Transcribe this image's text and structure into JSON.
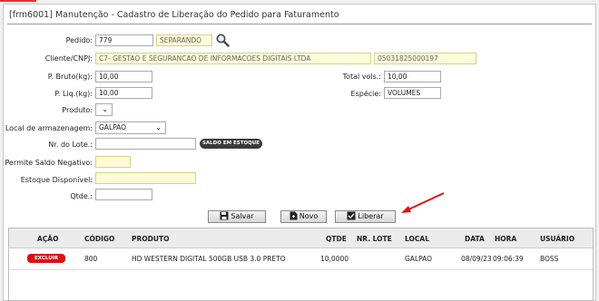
{
  "title": "[frm6001] Manutenção - Cadastro de Liberação do Pedido para Faturamento",
  "form": {
    "pedido_label": "Pedido:",
    "pedido_value": "779",
    "status_value": "SEPARANDO",
    "cliente_label": "Cliente/CNPJ:",
    "cliente_value": "C7- GESTAO E SEGURANCAO DE INFORMACOES DIGITAIS LTDA",
    "cnpj_value": "05031825000197",
    "peso_bruto_label": "P. Bruto(kg):",
    "peso_bruto_value": "10,00",
    "total_vols_label": "Total vols.:",
    "total_vols_value": "10,00",
    "peso_liq_label": "P. Liq.(kg):",
    "peso_liq_value": "10,00",
    "especie_label": "Espécie:",
    "especie_value": "VOLUMES",
    "produto_label": "Produto:",
    "produto_value": "",
    "local_label": "Local de armazenagem:",
    "local_value": "GALPAO",
    "lote_label": "Nr. do Lote.:",
    "lote_value": "",
    "saldo_button": "SALDO EM ESTOQUE",
    "permite_label": "Permite Saldo Negativo:",
    "permite_value": "",
    "estoque_label": "Estoque Disponível:",
    "estoque_value": "",
    "qtde_label": "Qtde.:",
    "qtde_value": ""
  },
  "buttons": {
    "salvar": "Salvar",
    "novo": "Novo",
    "liberar": "Liberar"
  },
  "table": {
    "headers": {
      "acao": "AÇÃO",
      "codigo": "CÓDIGO",
      "produto": "PRODUTO",
      "qtde": "QTDE",
      "lote": "NR. LOTE",
      "local": "LOCAL",
      "data": "DATA",
      "hora": "HORA",
      "usuario": "USUÁRIO"
    },
    "rows": [
      {
        "acao": "EXCLUIR",
        "codigo": "800",
        "produto": "HD WESTERN DIGITAL 500GB USB 3.0 PRETO",
        "qtde": "10,0000",
        "lote": "",
        "local": "GALPAO",
        "data": "08/09/23",
        "hora": "09:06:39",
        "usuario": "BOSS"
      }
    ]
  },
  "colors": {
    "yellow_field": "#fffbd6",
    "delete_button": "#dd1111",
    "annotation_arrow": "#dd1111"
  }
}
